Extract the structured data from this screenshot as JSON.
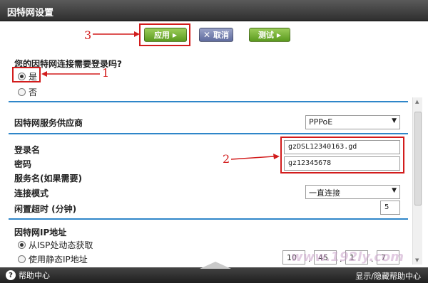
{
  "window": {
    "title": "因特网设置"
  },
  "toolbar": {
    "apply": "应用",
    "cancel": "取消",
    "test": "测试"
  },
  "login_question": "您的因特网连接需要登录吗?",
  "login_options": {
    "yes": "是",
    "no": "否",
    "selected": "是"
  },
  "isp": {
    "label": "因特网服务供应商",
    "value": "PPPoE"
  },
  "username": {
    "label": "登录名",
    "value": "gzDSL12340163.gd"
  },
  "password": {
    "label": "密码",
    "value": "gz12345678"
  },
  "service_name": {
    "label": "服务名(如果需要)"
  },
  "connection_mode": {
    "label": "连接模式",
    "value": "一直连接"
  },
  "idle_timeout": {
    "label": "闲置超时 (分钟)",
    "value": "5"
  },
  "ip_section": {
    "title": "因特网IP地址",
    "dynamic": "从ISP处动态获取",
    "static": "使用静态IP地址",
    "selected": "从ISP处动态获取",
    "ip": [
      "10",
      "45",
      "1",
      "7"
    ]
  },
  "annotations": {
    "n1": "1",
    "n2": "2",
    "n3": "3"
  },
  "footer": {
    "help": "帮助中心",
    "show": "显示/隐藏帮助中心"
  },
  "watermark": "www.192ly.com",
  "colors": {
    "accent_blue": "#2f86c9",
    "annotation_red": "#d21c1c",
    "button_green": "#6aaa2a"
  }
}
